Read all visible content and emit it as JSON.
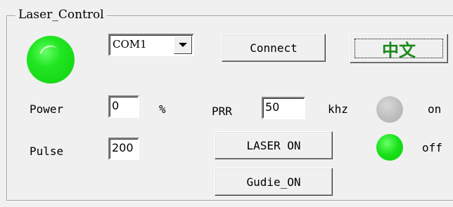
{
  "group": {
    "title": "Laser_Control"
  },
  "connection": {
    "port_value": "COM1",
    "connect_label": "Connect",
    "language_label": "中文"
  },
  "power": {
    "label": "Power",
    "value": "0",
    "unit": "%"
  },
  "prr": {
    "label": "PRR",
    "value": "50",
    "unit": "khz"
  },
  "pulse": {
    "label": "Pulse",
    "value": "200"
  },
  "buttons": {
    "laser_on_label": "LASER ON",
    "guide_on_label": "Gudie_ON"
  },
  "indicators": {
    "on_label": "on",
    "off_label": "off",
    "connection_led_color": "#22e622",
    "on_led_color": "#bcbcbc",
    "off_led_color": "#18e018"
  }
}
